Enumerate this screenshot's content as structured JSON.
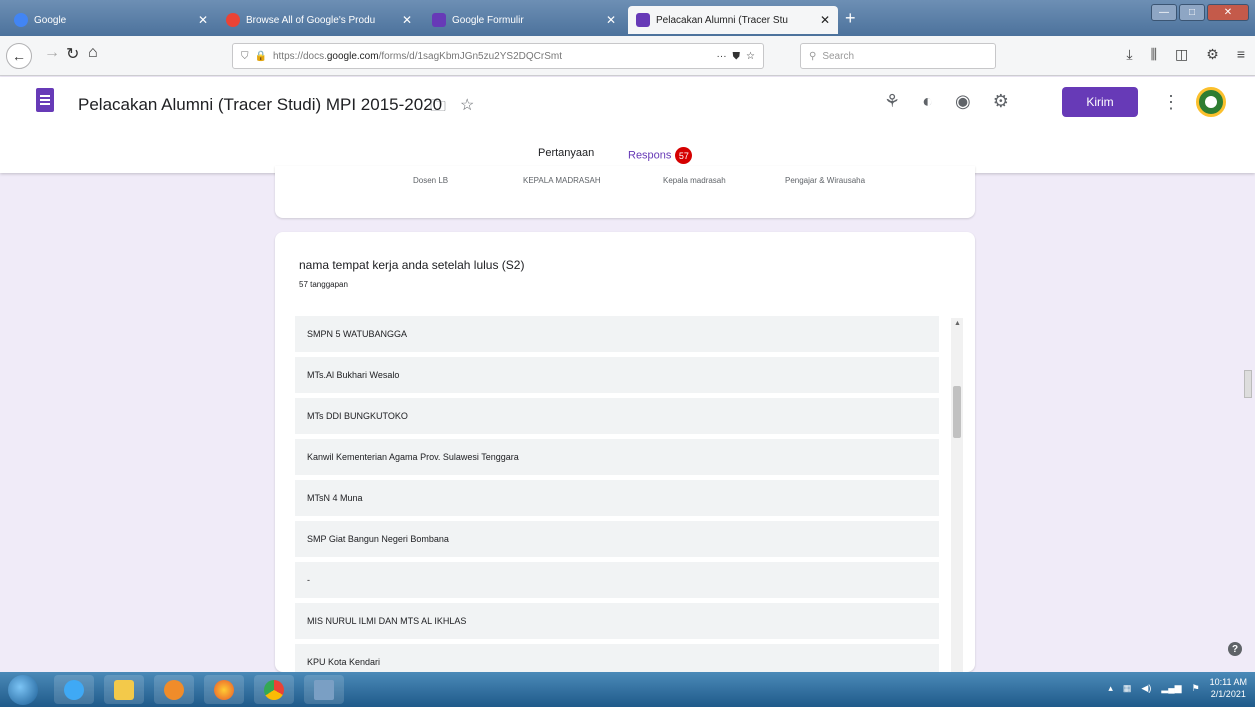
{
  "browser": {
    "tabs": [
      {
        "label": "Google",
        "favicon_color": "#4285f4"
      },
      {
        "label": "Browse All of Google's Produ",
        "favicon_color": "#ea4335"
      },
      {
        "label": "Google Formulir",
        "favicon_color": "#673ab7"
      },
      {
        "label": "Pelacakan Alumni (Tracer Stu",
        "favicon_color": "#673ab7",
        "active": true
      }
    ],
    "new_tab_label": "+",
    "url_prefix": "https://docs.",
    "url_host": "google.com",
    "url_rest": "/forms/d/1sagKbmJGn5zu2YS2DQCrSmt",
    "url_more": "···",
    "search_placeholder": "Search"
  },
  "form_header": {
    "title": "Pelacakan Alumni (Tracer Studi) MPI 2015-2020",
    "send_label": "Kirim",
    "tabs": [
      {
        "label": "Pertanyaan"
      },
      {
        "label": "Respons",
        "badge": "57",
        "active": true
      }
    ]
  },
  "previous_card": {
    "labels": [
      "Dosen LB",
      "KEPALA MADRASAH",
      "Kepala madrasah",
      "Pengajar & Wirausaha"
    ]
  },
  "question_card": {
    "title": "nama tempat kerja anda setelah lulus (S2)",
    "response_count": "57 tanggapan",
    "responses": [
      "SMPN 5 WATUBANGGA",
      "MTs.Al Bukhari Wesalo",
      "MTs DDI BUNGKUTOKO",
      "Kanwil Kementerian Agama Prov. Sulawesi Tenggara",
      "MTsN 4 Muna",
      "SMP Giat Bangun Negeri Bombana",
      "-",
      "MIS NURUL ILMI DAN MTS AL IKHLAS",
      "KPU Kota Kendari"
    ]
  },
  "taskbar": {
    "time": "10:11 AM",
    "date": "2/1/2021"
  },
  "colors": {
    "accent": "#673ab7",
    "badge": "#d50000",
    "page_bg": "#f0ebf8"
  }
}
